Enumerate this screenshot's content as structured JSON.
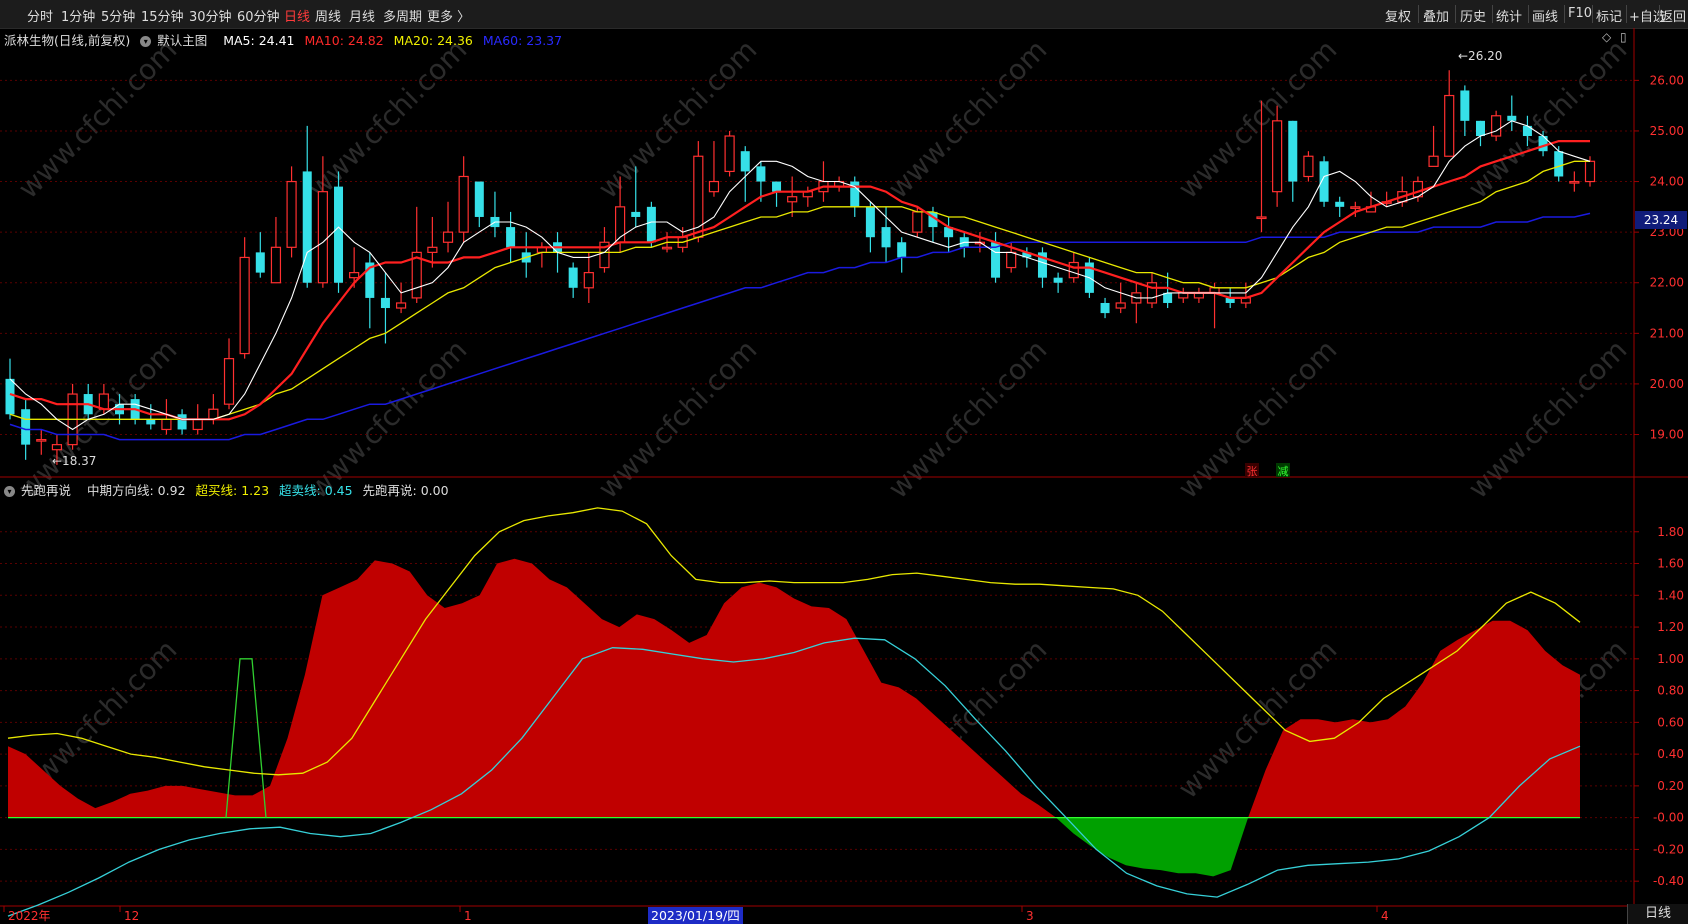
{
  "toolbar": {
    "periods": [
      "分时",
      "1分钟",
      "5分钟",
      "15分钟",
      "30分钟",
      "60分钟",
      "日线",
      "周线",
      "月线",
      "多周期",
      "更多 〉"
    ],
    "active_period": "日线",
    "right_items": [
      "复权",
      "叠加",
      "历史",
      "统计",
      "画线",
      "F10",
      "标记",
      "+自选",
      "返回"
    ]
  },
  "main_info": {
    "stock": "派林生物(日线,前复权)",
    "template": "默认主图",
    "ma5": "MA5: 24.41",
    "ma10": "MA10: 24.82",
    "ma20": "MA20: 24.36",
    "ma60": "MA60: 23.37"
  },
  "sub_info": {
    "name": "先跑再说",
    "mid_line": "中期方向线: 0.92",
    "overbuy": "超买线: 1.23",
    "oversell": "超卖线: 0.45",
    "xpzs": "先跑再说: 0.00"
  },
  "price_axis": [
    "26.00",
    "25.00",
    "24.00",
    "23.00",
    "22.00",
    "21.00",
    "20.00",
    "19.00"
  ],
  "current_price_label": "23.24",
  "high_mark": "26.20",
  "low_mark": "18.37",
  "zhang_label": "张",
  "jian_label": "减",
  "sub_axis": [
    "1.80",
    "1.60",
    "1.40",
    "1.20",
    "1.00",
    "0.80",
    "0.60",
    "0.40",
    "0.20",
    "-0.00",
    "-0.20",
    "-0.40"
  ],
  "date_axis": [
    "2022年",
    "12",
    "1",
    "3",
    "4"
  ],
  "crosshair_date": "2023/01/19/四",
  "bottom_tab": "日线",
  "watermark": "www.cfchi.com",
  "colors": {
    "up": "#ff3030",
    "down": "#36e0e8",
    "ma5": "#ffffff",
    "ma10": "#ff2020",
    "ma20": "#e8e800",
    "ma60": "#1a1ae0",
    "area_pos": "#c00000",
    "area_neg": "#00a000",
    "grid": "#5a0000"
  },
  "chart_data": {
    "type": "candlestick",
    "ylim": [
      18.2,
      26.6
    ],
    "candles": [
      [
        20.1,
        19.4,
        20.5,
        19.3
      ],
      [
        19.5,
        18.8,
        19.7,
        18.5
      ],
      [
        18.9,
        18.9,
        19.1,
        18.6
      ],
      [
        18.7,
        18.8,
        19.0,
        18.4
      ],
      [
        18.8,
        19.8,
        20.0,
        18.7
      ],
      [
        19.8,
        19.4,
        20.0,
        19.3
      ],
      [
        19.5,
        19.8,
        20.0,
        19.4
      ],
      [
        19.6,
        19.4,
        19.8,
        19.2
      ],
      [
        19.7,
        19.3,
        19.8,
        19.2
      ],
      [
        19.3,
        19.2,
        19.6,
        19.1
      ],
      [
        19.1,
        19.3,
        19.7,
        19.0
      ],
      [
        19.4,
        19.1,
        19.5,
        19.0
      ],
      [
        19.1,
        19.3,
        19.6,
        19.0
      ],
      [
        19.3,
        19.5,
        19.8,
        19.2
      ],
      [
        19.6,
        20.5,
        20.9,
        19.5
      ],
      [
        20.6,
        22.5,
        22.9,
        20.5
      ],
      [
        22.6,
        22.2,
        23.0,
        22.1
      ],
      [
        22.0,
        22.7,
        23.3,
        22.0
      ],
      [
        22.7,
        24.0,
        24.3,
        22.5
      ],
      [
        24.2,
        22.0,
        25.1,
        21.9
      ],
      [
        22.0,
        23.8,
        24.5,
        21.9
      ],
      [
        23.9,
        22.0,
        24.2,
        21.8
      ],
      [
        22.1,
        22.2,
        22.7,
        21.9
      ],
      [
        22.4,
        21.7,
        22.6,
        21.1
      ],
      [
        21.7,
        21.5,
        22.2,
        20.8
      ],
      [
        21.5,
        21.6,
        22.0,
        21.4
      ],
      [
        21.7,
        22.6,
        23.5,
        21.6
      ],
      [
        22.6,
        22.7,
        23.3,
        22.3
      ],
      [
        22.8,
        23.0,
        23.6,
        22.6
      ],
      [
        23.0,
        24.1,
        24.5,
        22.8
      ],
      [
        24.0,
        23.3,
        23.8,
        23.1
      ],
      [
        23.3,
        23.1,
        23.8,
        22.9
      ],
      [
        23.1,
        22.7,
        23.4,
        22.4
      ],
      [
        22.6,
        22.4,
        23.0,
        22.1
      ],
      [
        22.6,
        22.7,
        22.8,
        22.3
      ],
      [
        22.8,
        22.6,
        23.0,
        22.2
      ],
      [
        22.3,
        21.9,
        22.4,
        21.7
      ],
      [
        21.9,
        22.2,
        22.6,
        21.6
      ],
      [
        22.3,
        22.8,
        23.1,
        22.2
      ],
      [
        22.8,
        23.5,
        24.1,
        22.6
      ],
      [
        23.4,
        23.3,
        24.3,
        23.1
      ],
      [
        23.5,
        22.8,
        23.6,
        22.7
      ],
      [
        22.7,
        22.7,
        23.0,
        22.6
      ],
      [
        22.7,
        22.9,
        23.1,
        22.6
      ],
      [
        22.9,
        24.5,
        24.8,
        22.8
      ],
      [
        23.8,
        24.0,
        24.8,
        23.7
      ],
      [
        24.2,
        24.9,
        25.0,
        24.1
      ],
      [
        24.6,
        24.2,
        24.7,
        23.6
      ],
      [
        24.3,
        24.0,
        24.4,
        23.6
      ],
      [
        24.0,
        23.8,
        24.0,
        23.5
      ],
      [
        23.6,
        23.7,
        24.1,
        23.3
      ],
      [
        23.7,
        23.8,
        23.9,
        23.5
      ],
      [
        23.8,
        24.0,
        24.4,
        23.6
      ],
      [
        23.9,
        24.0,
        24.1,
        23.8
      ],
      [
        24.0,
        23.5,
        24.1,
        23.3
      ],
      [
        23.5,
        22.9,
        23.6,
        22.6
      ],
      [
        23.1,
        22.7,
        23.5,
        22.4
      ],
      [
        22.8,
        22.5,
        22.9,
        22.2
      ],
      [
        23.0,
        23.4,
        23.5,
        22.9
      ],
      [
        23.4,
        23.1,
        23.5,
        22.8
      ],
      [
        23.1,
        22.9,
        23.3,
        22.6
      ],
      [
        22.9,
        22.7,
        23.0,
        22.5
      ],
      [
        22.8,
        22.8,
        23.0,
        22.6
      ],
      [
        22.8,
        22.1,
        23.0,
        22.0
      ],
      [
        22.3,
        22.6,
        22.8,
        22.2
      ],
      [
        22.6,
        22.5,
        22.7,
        22.3
      ],
      [
        22.6,
        22.1,
        22.7,
        21.9
      ],
      [
        22.1,
        22.0,
        22.2,
        21.8
      ],
      [
        22.1,
        22.4,
        22.6,
        22.0
      ],
      [
        22.4,
        21.8,
        22.5,
        21.7
      ],
      [
        21.6,
        21.4,
        21.7,
        21.3
      ],
      [
        21.5,
        21.6,
        22.0,
        21.4
      ],
      [
        21.6,
        21.8,
        22.0,
        21.2
      ],
      [
        21.6,
        22.0,
        22.2,
        21.5
      ],
      [
        21.8,
        21.6,
        22.2,
        21.5
      ],
      [
        21.7,
        21.8,
        21.9,
        21.6
      ],
      [
        21.7,
        21.8,
        21.9,
        21.6
      ],
      [
        21.8,
        21.9,
        22.0,
        21.1
      ],
      [
        21.7,
        21.6,
        21.9,
        21.5
      ],
      [
        21.6,
        21.7,
        22.0,
        21.5
      ],
      [
        23.3,
        23.3,
        25.6,
        23.0
      ],
      [
        23.8,
        25.2,
        25.5,
        23.5
      ],
      [
        25.2,
        24.0,
        25.2,
        23.6
      ],
      [
        24.1,
        24.5,
        24.6,
        24.0
      ],
      [
        24.4,
        23.6,
        24.5,
        23.5
      ],
      [
        23.6,
        23.5,
        23.7,
        23.3
      ],
      [
        23.5,
        23.5,
        23.6,
        23.3
      ],
      [
        23.4,
        23.5,
        23.8,
        23.4
      ],
      [
        23.6,
        23.6,
        23.8,
        23.5
      ],
      [
        23.6,
        23.8,
        24.1,
        23.5
      ],
      [
        23.7,
        24.0,
        24.1,
        23.6
      ],
      [
        24.3,
        24.5,
        25.1,
        24.3
      ],
      [
        24.5,
        25.7,
        26.2,
        24.5
      ],
      [
        25.8,
        25.2,
        25.9,
        24.9
      ],
      [
        25.2,
        24.9,
        25.2,
        24.7
      ],
      [
        24.9,
        25.3,
        25.4,
        24.8
      ],
      [
        25.3,
        25.2,
        25.7,
        25.0
      ],
      [
        25.1,
        24.9,
        25.3,
        24.7
      ],
      [
        24.9,
        24.6,
        25.0,
        24.5
      ],
      [
        24.6,
        24.1,
        24.7,
        24.0
      ],
      [
        24.0,
        24.0,
        24.2,
        23.8
      ],
      [
        24.0,
        24.4,
        24.5,
        23.9
      ]
    ],
    "ma5": [
      20.1,
      19.8,
      19.6,
      19.3,
      19.1,
      19.3,
      19.4,
      19.6,
      19.6,
      19.5,
      19.4,
      19.3,
      19.3,
      19.3,
      19.4,
      19.8,
      20.4,
      21.0,
      21.7,
      22.6,
      22.8,
      23.1,
      22.8,
      22.6,
      22.2,
      21.8,
      21.9,
      22.0,
      22.3,
      22.8,
      23.0,
      23.2,
      23.2,
      23.1,
      22.9,
      22.6,
      22.5,
      22.5,
      22.6,
      22.9,
      23.1,
      23.2,
      23.2,
      23.0,
      23.1,
      23.3,
      23.8,
      24.1,
      24.4,
      24.4,
      24.3,
      24.1,
      24.0,
      24.0,
      23.9,
      23.6,
      23.3,
      23.0,
      22.9,
      22.8,
      22.7,
      22.8,
      22.8,
      22.6,
      22.6,
      22.5,
      22.4,
      22.3,
      22.2,
      22.1,
      21.9,
      21.8,
      21.7,
      21.7,
      21.8,
      21.8,
      21.8,
      21.8,
      21.8,
      21.8,
      22.1,
      22.6,
      23.1,
      23.5,
      24.1,
      24.2,
      24.0,
      23.7,
      23.5,
      23.6,
      23.7,
      23.9,
      24.4,
      24.7,
      24.9,
      25.0,
      25.2,
      25.1,
      24.9,
      24.6,
      24.5,
      24.4
    ],
    "ma10": [
      19.8,
      19.7,
      19.7,
      19.6,
      19.6,
      19.6,
      19.5,
      19.5,
      19.5,
      19.4,
      19.4,
      19.3,
      19.3,
      19.3,
      19.3,
      19.4,
      19.6,
      19.9,
      20.2,
      20.7,
      21.2,
      21.6,
      22.0,
      22.3,
      22.4,
      22.4,
      22.5,
      22.4,
      22.4,
      22.5,
      22.5,
      22.6,
      22.7,
      22.7,
      22.7,
      22.7,
      22.7,
      22.7,
      22.7,
      22.8,
      22.8,
      22.8,
      22.9,
      22.9,
      23.0,
      23.1,
      23.3,
      23.5,
      23.7,
      23.8,
      23.8,
      23.8,
      23.9,
      23.9,
      23.9,
      23.9,
      23.8,
      23.6,
      23.5,
      23.3,
      23.1,
      23.0,
      22.9,
      22.8,
      22.7,
      22.6,
      22.5,
      22.4,
      22.3,
      22.3,
      22.2,
      22.1,
      22.0,
      21.9,
      21.9,
      21.8,
      21.8,
      21.8,
      21.7,
      21.7,
      21.8,
      22.1,
      22.4,
      22.7,
      23.0,
      23.2,
      23.4,
      23.5,
      23.6,
      23.7,
      23.8,
      23.9,
      24.0,
      24.1,
      24.3,
      24.4,
      24.5,
      24.6,
      24.7,
      24.8,
      24.8,
      24.8
    ],
    "ma20": [
      19.4,
      19.3,
      19.3,
      19.3,
      19.3,
      19.3,
      19.3,
      19.3,
      19.3,
      19.3,
      19.3,
      19.3,
      19.3,
      19.3,
      19.4,
      19.5,
      19.6,
      19.8,
      19.9,
      20.1,
      20.3,
      20.5,
      20.7,
      20.9,
      21.0,
      21.2,
      21.4,
      21.6,
      21.8,
      21.9,
      22.1,
      22.3,
      22.4,
      22.5,
      22.6,
      22.6,
      22.6,
      22.6,
      22.6,
      22.6,
      22.7,
      22.7,
      22.8,
      22.8,
      22.9,
      23.0,
      23.1,
      23.2,
      23.3,
      23.3,
      23.4,
      23.4,
      23.5,
      23.5,
      23.5,
      23.5,
      23.5,
      23.5,
      23.4,
      23.4,
      23.3,
      23.3,
      23.2,
      23.1,
      23.0,
      22.9,
      22.8,
      22.7,
      22.6,
      22.5,
      22.4,
      22.3,
      22.2,
      22.2,
      22.1,
      22.0,
      22.0,
      21.9,
      21.9,
      21.9,
      22.0,
      22.1,
      22.3,
      22.5,
      22.6,
      22.8,
      22.9,
      23.0,
      23.1,
      23.1,
      23.2,
      23.3,
      23.4,
      23.5,
      23.6,
      23.8,
      23.9,
      24.0,
      24.2,
      24.3,
      24.4,
      24.4
    ],
    "ma60": [
      19.2,
      19.1,
      19.1,
      19.0,
      19.0,
      19.0,
      19.0,
      18.9,
      18.9,
      18.9,
      18.9,
      18.9,
      18.9,
      18.9,
      18.9,
      19.0,
      19.0,
      19.1,
      19.2,
      19.3,
      19.3,
      19.4,
      19.5,
      19.6,
      19.6,
      19.7,
      19.8,
      19.9,
      20.0,
      20.1,
      20.2,
      20.3,
      20.4,
      20.5,
      20.6,
      20.7,
      20.8,
      20.9,
      21.0,
      21.1,
      21.2,
      21.3,
      21.4,
      21.5,
      21.6,
      21.7,
      21.8,
      21.9,
      21.9,
      22.0,
      22.1,
      22.2,
      22.2,
      22.3,
      22.3,
      22.4,
      22.4,
      22.5,
      22.5,
      22.6,
      22.6,
      22.7,
      22.7,
      22.7,
      22.8,
      22.8,
      22.8,
      22.8,
      22.8,
      22.8,
      22.8,
      22.8,
      22.8,
      22.8,
      22.8,
      22.8,
      22.8,
      22.8,
      22.8,
      22.8,
      22.9,
      22.9,
      22.9,
      22.9,
      22.9,
      23.0,
      23.0,
      23.0,
      23.0,
      23.0,
      23.0,
      23.1,
      23.1,
      23.1,
      23.1,
      23.2,
      23.2,
      23.2,
      23.3,
      23.3,
      23.3,
      23.37
    ],
    "indicator": {
      "ylim": [
        -0.55,
        2.0
      ],
      "area": [
        0.45,
        0.4,
        0.3,
        0.2,
        0.12,
        0.06,
        0.1,
        0.15,
        0.17,
        0.2,
        0.2,
        0.18,
        0.16,
        0.14,
        0.14,
        0.2,
        0.5,
        0.9,
        1.4,
        1.45,
        1.5,
        1.62,
        1.6,
        1.55,
        1.4,
        1.32,
        1.35,
        1.4,
        1.6,
        1.63,
        1.6,
        1.5,
        1.45,
        1.35,
        1.25,
        1.2,
        1.28,
        1.25,
        1.18,
        1.1,
        1.15,
        1.35,
        1.45,
        1.48,
        1.45,
        1.38,
        1.33,
        1.32,
        1.25,
        1.05,
        0.85,
        0.82,
        0.75,
        0.65,
        0.55,
        0.45,
        0.35,
        0.25,
        0.15,
        0.08,
        0.0,
        -0.1,
        -0.18,
        -0.25,
        -0.3,
        -0.32,
        -0.33,
        -0.35,
        -0.35,
        -0.37,
        -0.33,
        0.0,
        0.3,
        0.55,
        0.62,
        0.62,
        0.6,
        0.62,
        0.6,
        0.62,
        0.7,
        0.85,
        1.05,
        1.12,
        1.18,
        1.24,
        1.24,
        1.18,
        1.05,
        0.96,
        0.9
      ],
      "yellow": [
        0.5,
        0.52,
        0.53,
        0.5,
        0.45,
        0.4,
        0.38,
        0.35,
        0.32,
        0.3,
        0.28,
        0.27,
        0.28,
        0.35,
        0.5,
        0.75,
        1.0,
        1.25,
        1.45,
        1.65,
        1.8,
        1.87,
        1.9,
        1.92,
        1.95,
        1.93,
        1.85,
        1.65,
        1.5,
        1.48,
        1.48,
        1.49,
        1.48,
        1.48,
        1.48,
        1.5,
        1.53,
        1.54,
        1.52,
        1.5,
        1.48,
        1.47,
        1.47,
        1.46,
        1.45,
        1.44,
        1.4,
        1.3,
        1.15,
        1.0,
        0.85,
        0.7,
        0.55,
        0.48,
        0.5,
        0.6,
        0.75,
        0.85,
        0.95,
        1.05,
        1.2,
        1.35,
        1.42,
        1.35,
        1.23
      ],
      "cyan": [
        -0.62,
        -0.55,
        -0.47,
        -0.38,
        -0.28,
        -0.2,
        -0.14,
        -0.1,
        -0.07,
        -0.06,
        -0.1,
        -0.12,
        -0.1,
        -0.03,
        0.05,
        0.15,
        0.3,
        0.5,
        0.75,
        1.0,
        1.07,
        1.06,
        1.03,
        1.0,
        0.98,
        1.0,
        1.04,
        1.1,
        1.13,
        1.12,
        1.0,
        0.83,
        0.62,
        0.42,
        0.2,
        0.0,
        -0.2,
        -0.35,
        -0.43,
        -0.48,
        -0.5,
        -0.42,
        -0.33,
        -0.3,
        -0.29,
        -0.28,
        -0.26,
        -0.21,
        -0.12,
        0.0,
        0.2,
        0.37,
        0.45
      ],
      "green_pulse": [
        0,
        0,
        0,
        0,
        0,
        0,
        0,
        0,
        0,
        0,
        0,
        0,
        0,
        0,
        0,
        0,
        0,
        0,
        1,
        1,
        0,
        0
      ]
    }
  }
}
